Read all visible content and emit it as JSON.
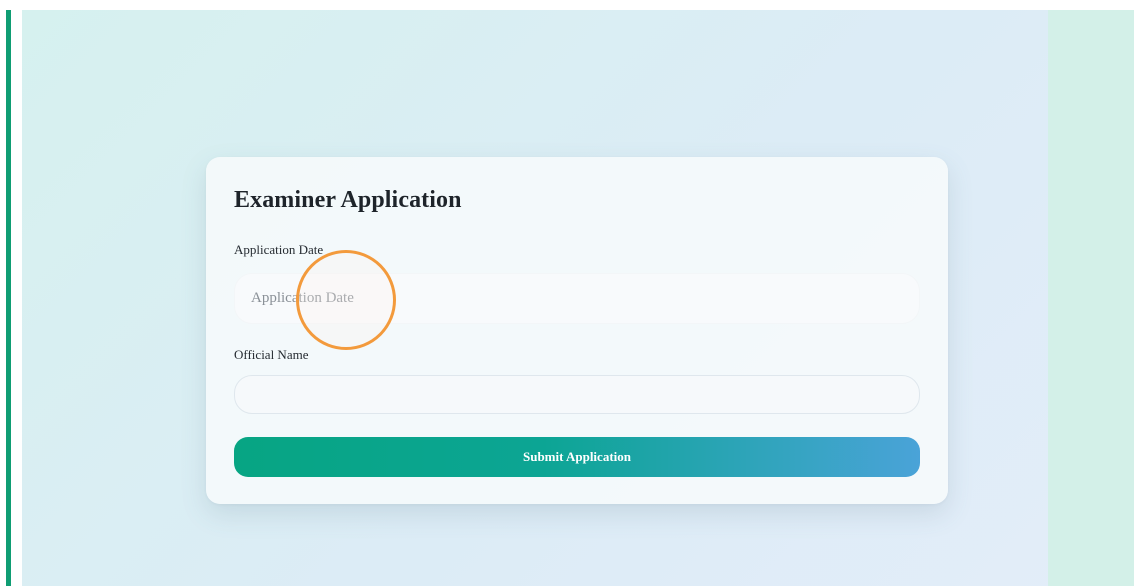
{
  "form": {
    "title": "Examiner Application",
    "application_date": {
      "label": "Application Date",
      "placeholder": "Application Date",
      "value": ""
    },
    "official_name": {
      "label": "Official Name",
      "placeholder": "",
      "value": ""
    },
    "submit_label": "Submit Application"
  },
  "colors": {
    "accent": "#0f9d73",
    "button_gradient_start": "#07a583",
    "button_gradient_end": "#4aa3d8",
    "click_indicator": "#f39a3c"
  }
}
